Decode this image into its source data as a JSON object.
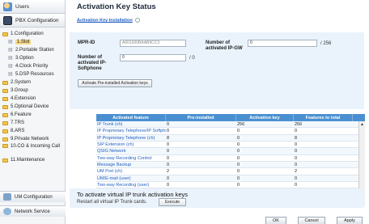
{
  "sidebar": {
    "users": "Users",
    "pbx": "PBX Configuration",
    "tree": [
      {
        "label": "1.Configuration",
        "level": 1,
        "type": "folder"
      },
      {
        "label": "1.Slot",
        "level": 2,
        "type": "leaf",
        "selected": true
      },
      {
        "label": "2.Portable Station",
        "level": 2,
        "type": "leaf"
      },
      {
        "label": "3.Option",
        "level": 2,
        "type": "leaf"
      },
      {
        "label": "4.Clock Priority",
        "level": 2,
        "type": "leaf"
      },
      {
        "label": "5.DSP Resources",
        "level": 2,
        "type": "leaf"
      },
      {
        "label": "2.System",
        "level": 1,
        "type": "folder"
      },
      {
        "label": "3.Group",
        "level": 1,
        "type": "folder"
      },
      {
        "label": "4.Extension",
        "level": 1,
        "type": "folder"
      },
      {
        "label": "5.Optional Device",
        "level": 1,
        "type": "folder"
      },
      {
        "label": "6.Feature",
        "level": 1,
        "type": "folder"
      },
      {
        "label": "7.TRS",
        "level": 1,
        "type": "folder"
      },
      {
        "label": "8.ARS",
        "level": 1,
        "type": "folder"
      },
      {
        "label": "9.Private Network",
        "level": 1,
        "type": "folder"
      },
      {
        "label": "10.CO & Incoming Call",
        "level": 1,
        "type": "folder",
        "tall": true
      },
      {
        "label": "11.Maintenance",
        "level": 1,
        "type": "folder"
      }
    ],
    "um_config": "UM Configuration",
    "network": "Network Service"
  },
  "main": {
    "title": "Activation Key Status",
    "breadcrumb": "Activation Key Installation",
    "mpr_id_label": "MPR-ID",
    "mpr_id_value": "A001000BAAB9CC3",
    "ipgw_label": "Number of activated IP-GW",
    "ipgw_value": "0",
    "ipgw_max": "/ 256",
    "softphone_label": "Number of activated IP-Softphone",
    "softphone_value": "0",
    "softphone_max": "/ 0",
    "activate_btn": "Activate Pre-installed Activation keys"
  },
  "table": {
    "headers": [
      "Activated feature",
      "Pre-installed",
      "Activation key",
      "Features to total"
    ],
    "rows": [
      [
        "IP Trunk (ch)",
        "0",
        "256",
        "256"
      ],
      [
        "IP Proprietary Telephone/IP Softphone (ch)",
        "0",
        "0",
        "0"
      ],
      [
        "IP Proprietary Telephone (ch)",
        "8",
        "0",
        "8"
      ],
      [
        "SIP Extension (ch)",
        "0",
        "0",
        "0"
      ],
      [
        "QSIG Network",
        "0",
        "0",
        "0"
      ],
      [
        "Two-way Recording Control",
        "0",
        "0",
        "0"
      ],
      [
        "Message Backup",
        "0",
        "0",
        "0"
      ],
      [
        "UM Port (ch)",
        "2",
        "0",
        "2"
      ],
      [
        "UM/E-mail (user)",
        "0",
        "0",
        "0"
      ],
      [
        "Two-way Recording (user)",
        "0",
        "0",
        "0"
      ]
    ]
  },
  "trunk": {
    "title": "To activate virtual IP trunk activation keys",
    "text": "Restart all virtual IP Trunk cards.",
    "execute": "Execute"
  },
  "footer": {
    "ok": "OK",
    "cancel": "Cancel",
    "apply": "Apply"
  },
  "colors": {
    "header_blue": "#4a90d0",
    "panel_bg": "#eaf3fb",
    "link": "#1f5fbf"
  }
}
